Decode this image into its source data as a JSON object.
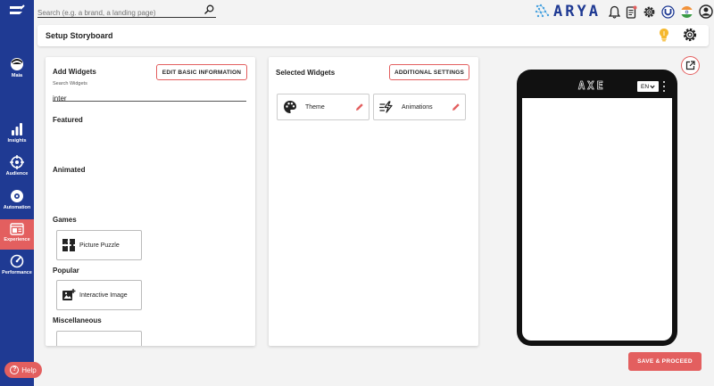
{
  "topbar": {
    "search_placeholder": "Search (e.g. a brand, a landing page)",
    "brand_name": "ARYA"
  },
  "sidebar": {
    "items": [
      {
        "label": "Maia",
        "icon": "maia-face-icon"
      },
      {
        "label": "Insights",
        "icon": "bar-chart-icon"
      },
      {
        "label": "Audience",
        "icon": "target-icon"
      },
      {
        "label": "Automation",
        "icon": "gear-icon"
      },
      {
        "label": "Experience",
        "icon": "browser-window-icon",
        "active": true
      },
      {
        "label": "Performance",
        "icon": "gauge-icon"
      }
    ],
    "help_label": "Help"
  },
  "header": {
    "title": "Setup Storyboard"
  },
  "add_widgets": {
    "title": "Add Widgets",
    "edit_button": "EDIT BASIC INFORMATION",
    "search_label": "Search Widgets",
    "search_value": "inter",
    "sections": {
      "featured": "Featured",
      "animated": "Animated",
      "games": "Games",
      "popular": "Popular",
      "misc": "Miscellaneous"
    },
    "games_items": [
      {
        "label": "Picture Puzzle",
        "icon": "puzzle-icon"
      }
    ],
    "popular_items": [
      {
        "label": "Interactive Image",
        "icon": "image-plus-icon"
      }
    ]
  },
  "selected_widgets": {
    "title": "Selected Widgets",
    "settings_button": "ADDITIONAL SETTINGS",
    "items": [
      {
        "label": "Theme",
        "icon": "palette-icon"
      },
      {
        "label": "Animations",
        "icon": "motion-icon"
      }
    ]
  },
  "preview": {
    "logo_text": "AXE",
    "language": "EN"
  },
  "footer": {
    "save_button": "SAVE & PROCEED"
  },
  "colors": {
    "sidebar": "#1f3a93",
    "accent": "#e35f5f",
    "bulb": "#f5b82e"
  }
}
